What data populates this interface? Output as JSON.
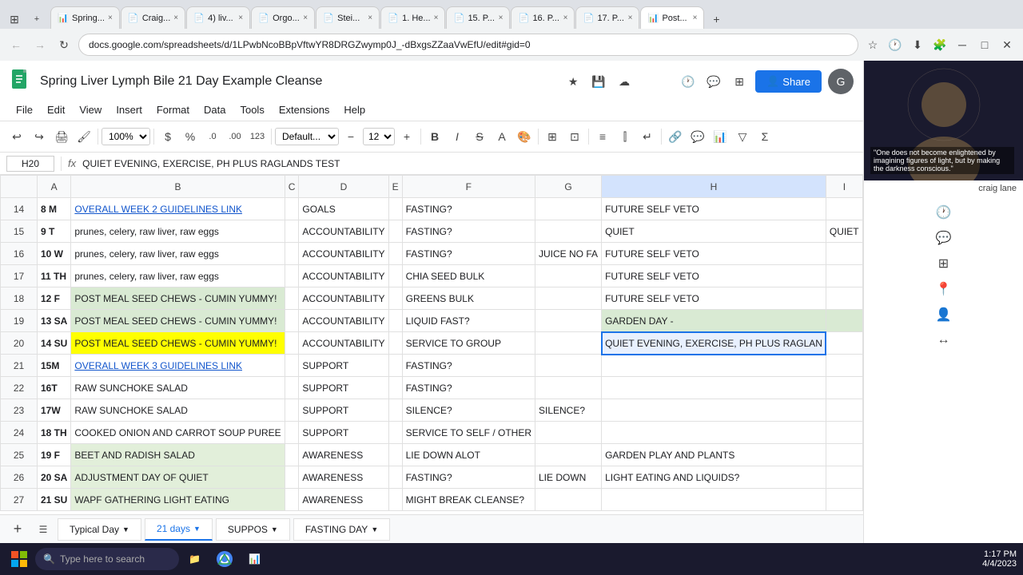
{
  "browser": {
    "url": "docs.google.com/spreadsheets/d/1LPwbNcoBBpVftwYR8DRGZwymp0J_-dBxgsZZaaVwEfU/edit#gid=0",
    "tabs": [
      {
        "label": "Spring...",
        "active": false,
        "icon": "📊"
      },
      {
        "label": "Craig...",
        "active": false,
        "icon": "📄"
      },
      {
        "label": "4) liv...",
        "active": false,
        "icon": "📄"
      },
      {
        "label": "Orgo...",
        "active": false,
        "icon": "📄"
      },
      {
        "label": "Stei...",
        "active": false,
        "icon": "📄"
      },
      {
        "label": "1. He...",
        "active": false,
        "icon": "📄"
      },
      {
        "label": "15. P...",
        "active": false,
        "icon": "📄"
      },
      {
        "label": "16. P...",
        "active": false,
        "icon": "📄"
      },
      {
        "label": "17. P...",
        "active": false,
        "icon": "📄"
      },
      {
        "label": "Post...",
        "active": true,
        "icon": "📊"
      }
    ]
  },
  "sheets": {
    "title": "Spring Liver Lymph Bile  21 Day Example Cleanse",
    "menu": [
      "File",
      "Edit",
      "View",
      "Insert",
      "Format",
      "Data",
      "Tools",
      "Extensions",
      "Help"
    ],
    "toolbar": {
      "zoom": "100%",
      "font": "Default...",
      "fontSize": "12"
    },
    "cellRef": "H20",
    "formula": "QUIET EVENING, EXERCISE, PH PLUS RAGLANDS TEST",
    "columnHeaders": [
      "",
      "A",
      "B",
      "C",
      "D",
      "E",
      "F",
      "G",
      "H",
      "I"
    ],
    "rows": [
      {
        "rowNum": "14",
        "cells": [
          {
            "col": "A",
            "val": "8 M",
            "bold": true
          },
          {
            "col": "B",
            "val": "OVERALL WEEK 2 GUIDELINES LINK",
            "link": true
          },
          {
            "col": "C",
            "val": ""
          },
          {
            "col": "D",
            "val": "GOALS"
          },
          {
            "col": "E",
            "val": ""
          },
          {
            "col": "F",
            "val": "FASTING?"
          },
          {
            "col": "G",
            "val": ""
          },
          {
            "col": "H",
            "val": "FUTURE SELF VETO"
          },
          {
            "col": "I",
            "val": ""
          }
        ]
      },
      {
        "rowNum": "15",
        "cells": [
          {
            "col": "A",
            "val": "9 T",
            "bold": true
          },
          {
            "col": "B",
            "val": "prunes, celery, raw liver, raw eggs"
          },
          {
            "col": "C",
            "val": ""
          },
          {
            "col": "D",
            "val": "ACCOUNTABILITY"
          },
          {
            "col": "E",
            "val": ""
          },
          {
            "col": "F",
            "val": "FASTING?"
          },
          {
            "col": "G",
            "val": ""
          },
          {
            "col": "H",
            "val": "QUIET"
          },
          {
            "col": "I",
            "val": "QUIET"
          }
        ]
      },
      {
        "rowNum": "16",
        "cells": [
          {
            "col": "A",
            "val": "10 W",
            "bold": true
          },
          {
            "col": "B",
            "val": "prunes, celery, raw liver, raw eggs"
          },
          {
            "col": "C",
            "val": ""
          },
          {
            "col": "D",
            "val": "ACCOUNTABILITY"
          },
          {
            "col": "E",
            "val": ""
          },
          {
            "col": "F",
            "val": "FASTING?"
          },
          {
            "col": "G",
            "val": "JUICE NO FA"
          },
          {
            "col": "H",
            "val": "FUTURE SELF VETO"
          },
          {
            "col": "I",
            "val": ""
          }
        ]
      },
      {
        "rowNum": "17",
        "cells": [
          {
            "col": "A",
            "val": "11 TH",
            "bold": true
          },
          {
            "col": "B",
            "val": "prunes, celery, raw liver, raw eggs"
          },
          {
            "col": "C",
            "val": ""
          },
          {
            "col": "D",
            "val": "ACCOUNTABILITY"
          },
          {
            "col": "E",
            "val": ""
          },
          {
            "col": "F",
            "val": "CHIA SEED BULK"
          },
          {
            "col": "G",
            "val": ""
          },
          {
            "col": "H",
            "val": "FUTURE SELF VETO"
          },
          {
            "col": "I",
            "val": ""
          }
        ]
      },
      {
        "rowNum": "18",
        "cells": [
          {
            "col": "A",
            "val": "12 F",
            "bold": true
          },
          {
            "col": "B",
            "val": "POST MEAL SEED CHEWS - CUMIN YUMMY!",
            "green": true
          },
          {
            "col": "C",
            "val": ""
          },
          {
            "col": "D",
            "val": "ACCOUNTABILITY"
          },
          {
            "col": "E",
            "val": ""
          },
          {
            "col": "F",
            "val": "GREENS BULK"
          },
          {
            "col": "G",
            "val": ""
          },
          {
            "col": "H",
            "val": "FUTURE SELF VETO"
          },
          {
            "col": "I",
            "val": ""
          }
        ]
      },
      {
        "rowNum": "19",
        "cells": [
          {
            "col": "A",
            "val": "13 SA",
            "bold": true
          },
          {
            "col": "B",
            "val": "POST MEAL SEED CHEWS - CUMIN YUMMY!",
            "green": true
          },
          {
            "col": "C",
            "val": ""
          },
          {
            "col": "D",
            "val": "ACCOUNTABILITY"
          },
          {
            "col": "E",
            "val": ""
          },
          {
            "col": "F",
            "val": "LIQUID FAST?"
          },
          {
            "col": "G",
            "val": ""
          },
          {
            "col": "H",
            "val": "GARDEN DAY -",
            "green": true
          },
          {
            "col": "I",
            "val": "",
            "green": true
          }
        ]
      },
      {
        "rowNum": "20",
        "cells": [
          {
            "col": "A",
            "val": "14 SU",
            "bold": true
          },
          {
            "col": "B",
            "val": "POST MEAL SEED CHEWS - CUMIN YUMMY!",
            "yellow": true
          },
          {
            "col": "C",
            "val": ""
          },
          {
            "col": "D",
            "val": "ACCOUNTABILITY"
          },
          {
            "col": "E",
            "val": ""
          },
          {
            "col": "F",
            "val": "SERVICE TO GROUP"
          },
          {
            "col": "G",
            "val": ""
          },
          {
            "col": "H",
            "val": "QUIET EVENING, EXERCISE, PH PLUS RAGLAN",
            "selected": true
          },
          {
            "col": "I",
            "val": ""
          }
        ]
      },
      {
        "rowNum": "21",
        "cells": [
          {
            "col": "A",
            "val": "15M",
            "bold": true
          },
          {
            "col": "B",
            "val": "OVERALL WEEK 3 GUIDELINES LINK",
            "link": true
          },
          {
            "col": "C",
            "val": ""
          },
          {
            "col": "D",
            "val": "SUPPORT"
          },
          {
            "col": "E",
            "val": ""
          },
          {
            "col": "F",
            "val": "FASTING?"
          },
          {
            "col": "G",
            "val": ""
          },
          {
            "col": "H",
            "val": ""
          },
          {
            "col": "I",
            "val": ""
          }
        ]
      },
      {
        "rowNum": "22",
        "cells": [
          {
            "col": "A",
            "val": "16T",
            "bold": true
          },
          {
            "col": "B",
            "val": "RAW SUNCHOKE SALAD"
          },
          {
            "col": "C",
            "val": ""
          },
          {
            "col": "D",
            "val": "SUPPORT"
          },
          {
            "col": "E",
            "val": ""
          },
          {
            "col": "F",
            "val": "FASTING?"
          },
          {
            "col": "G",
            "val": ""
          },
          {
            "col": "H",
            "val": ""
          },
          {
            "col": "I",
            "val": ""
          }
        ]
      },
      {
        "rowNum": "23",
        "cells": [
          {
            "col": "A",
            "val": "17W",
            "bold": true
          },
          {
            "col": "B",
            "val": "RAW SUNCHOKE SALAD"
          },
          {
            "col": "C",
            "val": ""
          },
          {
            "col": "D",
            "val": "SUPPORT"
          },
          {
            "col": "E",
            "val": ""
          },
          {
            "col": "F",
            "val": "SILENCE?"
          },
          {
            "col": "G",
            "val": "SILENCE?"
          },
          {
            "col": "H",
            "val": ""
          },
          {
            "col": "I",
            "val": ""
          }
        ]
      },
      {
        "rowNum": "24",
        "cells": [
          {
            "col": "A",
            "val": "18 TH",
            "bold": true
          },
          {
            "col": "B",
            "val": "COOKED ONION AND CARROT SOUP PUREE"
          },
          {
            "col": "C",
            "val": ""
          },
          {
            "col": "D",
            "val": "SUPPORT"
          },
          {
            "col": "E",
            "val": ""
          },
          {
            "col": "F",
            "val": "SERVICE TO SELF / OTHER"
          },
          {
            "col": "G",
            "val": ""
          },
          {
            "col": "H",
            "val": ""
          },
          {
            "col": "I",
            "val": ""
          }
        ]
      },
      {
        "rowNum": "25",
        "cells": [
          {
            "col": "A",
            "val": "19 F",
            "bold": true
          },
          {
            "col": "B",
            "val": "BEET AND RADISH SALAD",
            "light-green": true
          },
          {
            "col": "C",
            "val": ""
          },
          {
            "col": "D",
            "val": "AWARENESS"
          },
          {
            "col": "E",
            "val": ""
          },
          {
            "col": "F",
            "val": "LIE DOWN ALOT"
          },
          {
            "col": "G",
            "val": ""
          },
          {
            "col": "H",
            "val": "GARDEN PLAY AND PLANTS"
          },
          {
            "col": "I",
            "val": ""
          }
        ]
      },
      {
        "rowNum": "26",
        "cells": [
          {
            "col": "A",
            "val": "20 SA",
            "bold": true
          },
          {
            "col": "B",
            "val": "ADJUSTMENT DAY OF QUIET",
            "light-green": true
          },
          {
            "col": "C",
            "val": ""
          },
          {
            "col": "D",
            "val": "AWARENESS"
          },
          {
            "col": "E",
            "val": ""
          },
          {
            "col": "F",
            "val": "FASTING?"
          },
          {
            "col": "G",
            "val": "LIE DOWN"
          },
          {
            "col": "H",
            "val": "LIGHT EATING AND LIQUIDS?"
          },
          {
            "col": "I",
            "val": ""
          }
        ]
      },
      {
        "rowNum": "27",
        "cells": [
          {
            "col": "A",
            "val": "21 SU",
            "bold": true
          },
          {
            "col": "B",
            "val": "WAPF GATHERING LIGHT EATING",
            "light-green": true
          },
          {
            "col": "C",
            "val": ""
          },
          {
            "col": "D",
            "val": "AWARENESS"
          },
          {
            "col": "E",
            "val": ""
          },
          {
            "col": "F",
            "val": "MIGHT BREAK CLEANSE?"
          },
          {
            "col": "G",
            "val": ""
          },
          {
            "col": "H",
            "val": ""
          },
          {
            "col": "I",
            "val": ""
          }
        ]
      }
    ],
    "sheetTabs": [
      {
        "label": "Typical Day",
        "active": false
      },
      {
        "label": "21 days",
        "active": true
      },
      {
        "label": "SUPPOS",
        "active": false
      },
      {
        "label": "FASTING DAY",
        "active": false
      }
    ]
  },
  "taskbar": {
    "time": "1:17 PM",
    "date": "4/4/2023",
    "searchPlaceholder": "Type here to search"
  },
  "video": {
    "overlayText": "\"One does not become enlightened by imagining figures of light, but by making the darkness conscious.\"",
    "name": "craig lane"
  }
}
